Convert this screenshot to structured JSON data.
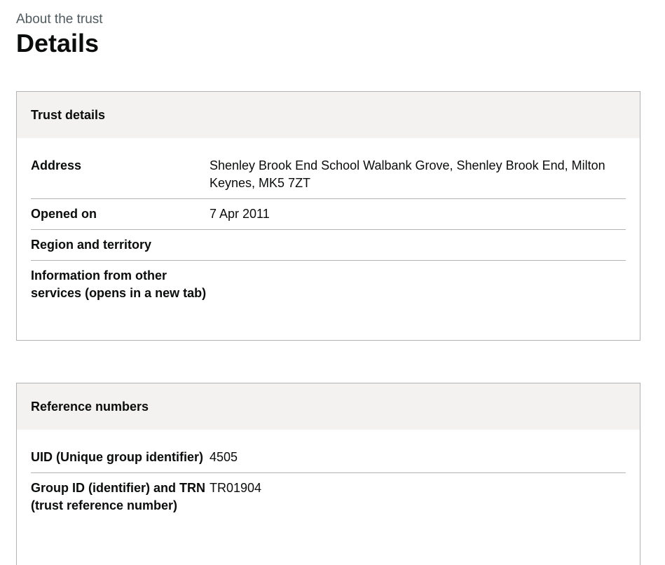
{
  "page": {
    "caption": "About the trust",
    "title": "Details"
  },
  "trust_details": {
    "heading": "Trust details",
    "rows": [
      {
        "key": "Address",
        "value": "Shenley Brook End School Walbank Grove, Shenley Brook End, Milton Keynes, MK5 7ZT"
      },
      {
        "key": "Opened on",
        "value": "7 Apr 2011"
      },
      {
        "key": "Region and territory",
        "value": ""
      },
      {
        "key": "Information from other services (opens in a new tab)",
        "value": ""
      }
    ]
  },
  "reference_numbers": {
    "heading": "Reference numbers",
    "rows": [
      {
        "key": "UID (Unique group identifier)",
        "value": "4505"
      },
      {
        "key": "Group ID (identifier) and TRN (trust reference number)",
        "value": "TR01904"
      }
    ]
  }
}
